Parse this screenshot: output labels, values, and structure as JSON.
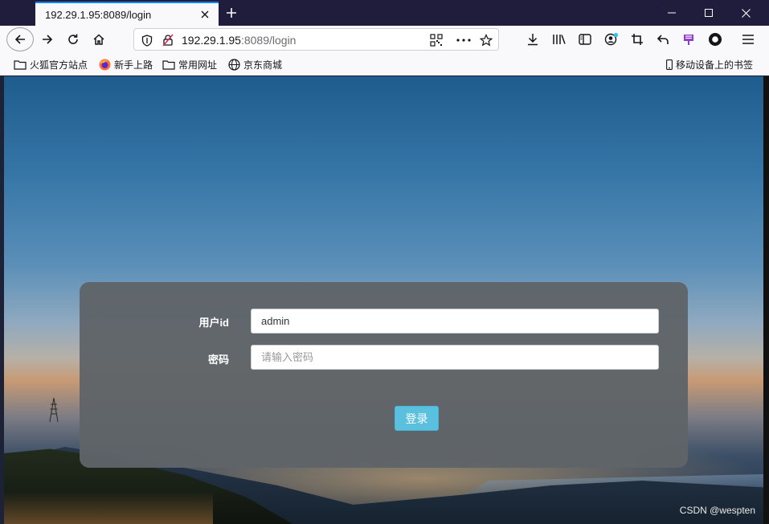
{
  "tab": {
    "title": "192.29.1.95:8089/login"
  },
  "url": {
    "host": "192.29.1.95",
    "rest": ":8089/login"
  },
  "bookmarks": [
    {
      "label": "火狐官方站点",
      "icon": "folder-icon"
    },
    {
      "label": "新手上路",
      "icon": "firefox-icon"
    },
    {
      "label": "常用网址",
      "icon": "folder-icon"
    },
    {
      "label": "京东商城",
      "icon": "globe-icon"
    }
  ],
  "mobile_bookmarks": "移动设备上的书签",
  "form": {
    "user_label": "用户id",
    "user_value": "admin",
    "password_label": "密码",
    "password_placeholder": "请输入密码",
    "submit_label": "登录"
  },
  "watermark": "CSDN @wespten",
  "colors": {
    "accent": "#0a84ff",
    "button": "#5bc0de",
    "panel": "#5f6468"
  }
}
